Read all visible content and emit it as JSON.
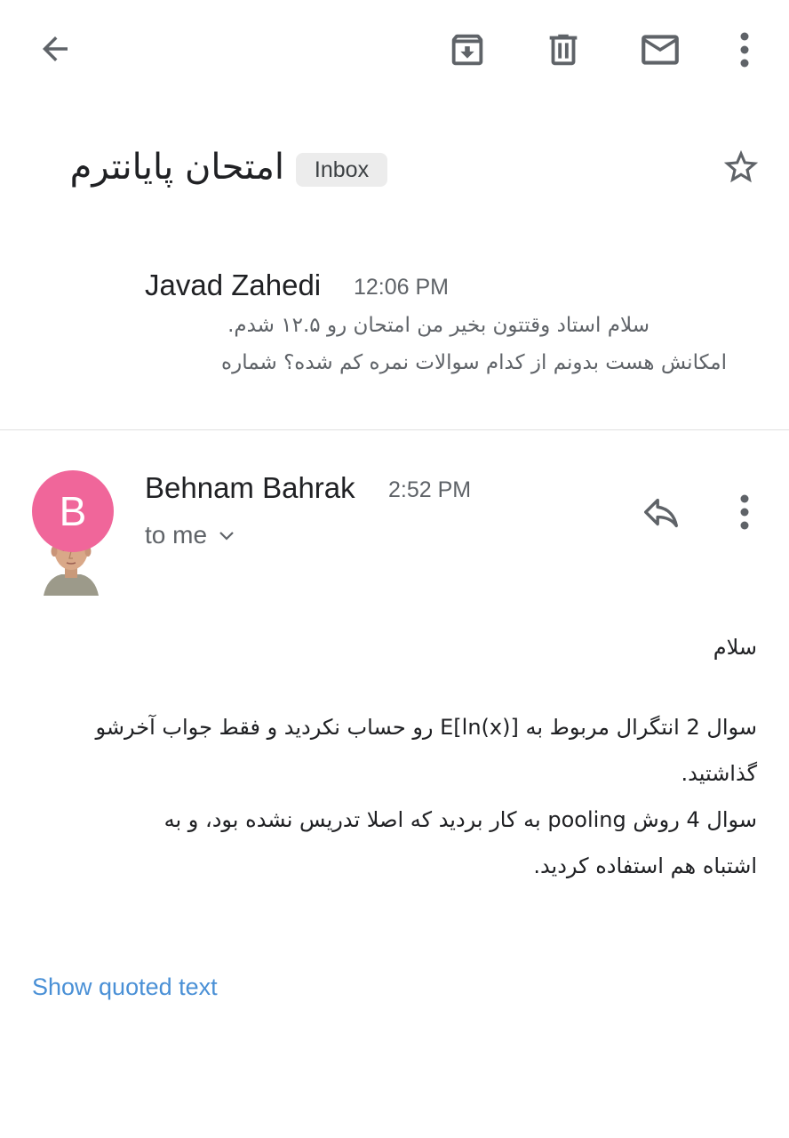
{
  "toolbar": {
    "back_icon": "arrow-left-icon",
    "archive_icon": "archive-icon",
    "delete_icon": "trash-icon",
    "mark_unread_icon": "mail-envelope-icon",
    "more_icon": "more-vert-icon"
  },
  "thread": {
    "subject": "امتحان پایانترم",
    "label": "Inbox",
    "starred": false,
    "star_icon": "star-outline-icon"
  },
  "messages": [
    {
      "sender": "Javad Zahedi",
      "time": "12:06 PM",
      "avatar": "user-photo",
      "collapsed": true,
      "snippet_lines": [
        "سلام استاد وقتتون بخیر من امتحان رو ۱۲.۵ شدم.",
        "امکانش هست بدونم از کدام سوالات نمره کم شده؟ شماره"
      ]
    },
    {
      "sender": "Behnam Bahrak",
      "time": "2:52 PM",
      "avatar_letter": "B",
      "avatar_color": "#f0669a",
      "recipient": "to me",
      "reply_icon": "reply-icon",
      "more_icon": "more-vert-icon",
      "body_lines": [
        "سلام",
        "سوال 2 انتگرال مربوط به E[ln(x)] رو حساب نکردید و فقط جواب آخرشو",
        "گذاشتید.",
        "سوال 4 روش pooling به کار بردید که اصلا تدریس نشده بود، و به",
        "اشتباه هم استفاده کردید."
      ],
      "show_quoted": "Show quoted text"
    }
  ],
  "colors": {
    "accent_link": "#4a90d6",
    "icon_gray": "#5f6368"
  }
}
